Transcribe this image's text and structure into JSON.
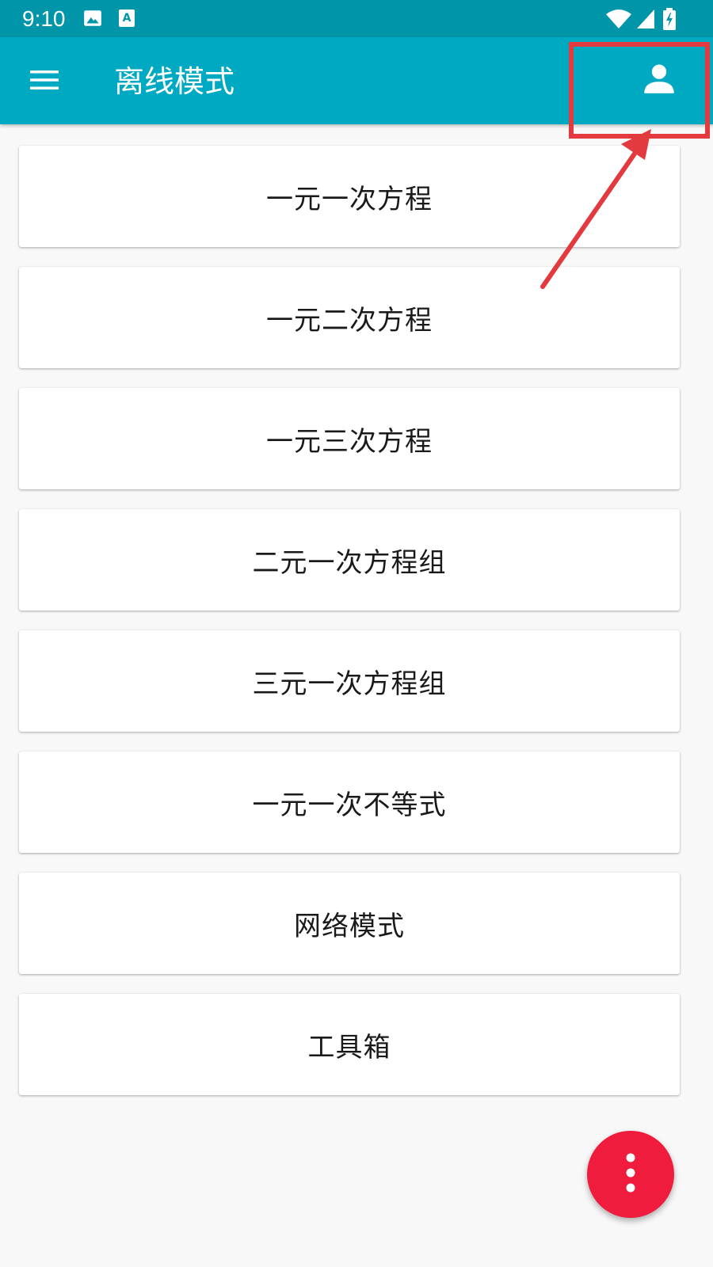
{
  "status_bar": {
    "time": "9:10",
    "icons": [
      "image-icon",
      "text-a-icon",
      "wifi-icon",
      "signal-icon",
      "battery-charging-icon"
    ]
  },
  "app_bar": {
    "title": "离线模式",
    "menu_icon": "hamburger-menu-icon",
    "account_icon": "person-icon"
  },
  "list": {
    "items": [
      {
        "label": "一元一次方程"
      },
      {
        "label": "一元二次方程"
      },
      {
        "label": "一元三次方程"
      },
      {
        "label": "二元一次方程组"
      },
      {
        "label": "三元一次方程组"
      },
      {
        "label": "一元一次不等式"
      },
      {
        "label": "网络模式"
      },
      {
        "label": "工具箱"
      }
    ]
  },
  "fab": {
    "icon": "more-vert-icon"
  },
  "colors": {
    "status_bar": "#0095a8",
    "app_bar": "#00a9c2",
    "fab": "#ef1c3e",
    "annotation": "#e23a3f",
    "background": "#f8f8f8"
  }
}
